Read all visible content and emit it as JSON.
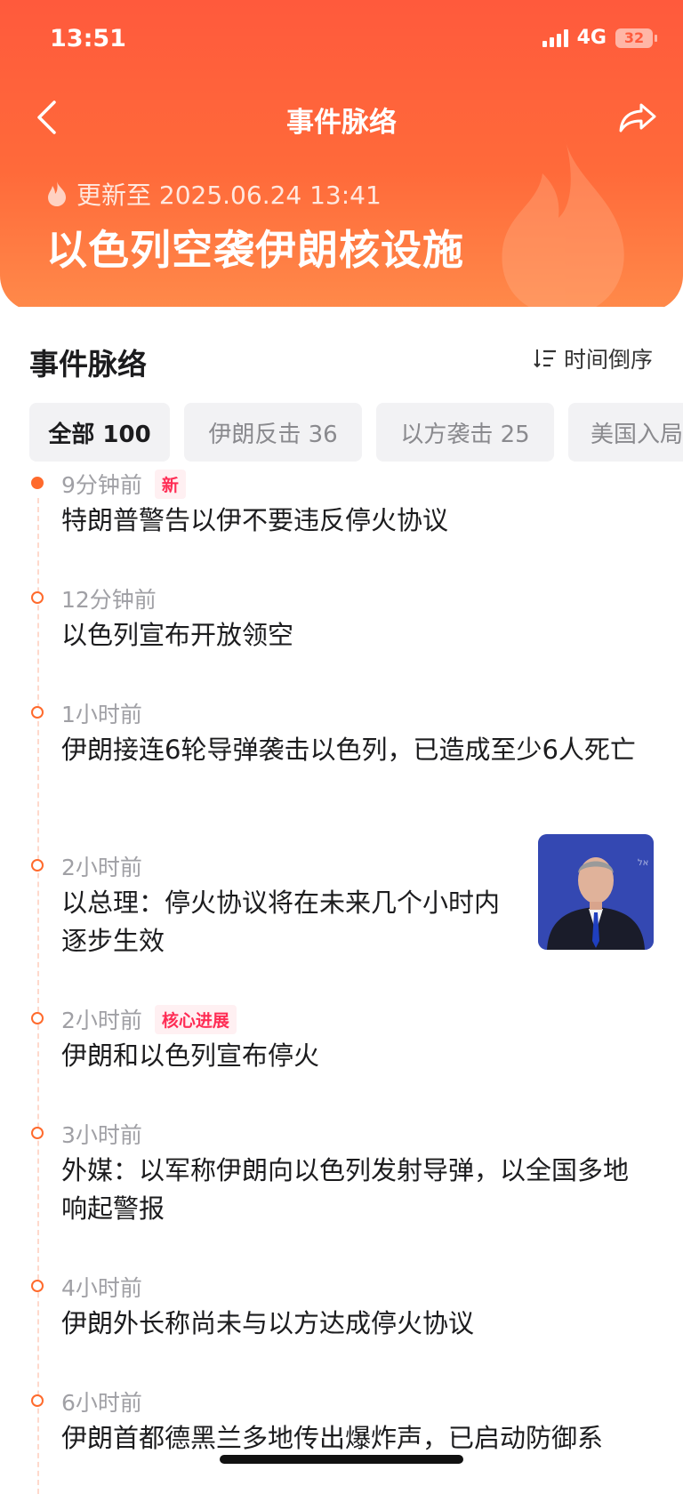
{
  "status_bar": {
    "time": "13:51",
    "network": "4G",
    "battery": "32"
  },
  "nav": {
    "title": "事件脉络",
    "back_icon": "chevron-left-icon",
    "share_icon": "share-icon"
  },
  "hero": {
    "update_text": "更新至 2025.06.24 13:41",
    "event_title": "以色列空袭伊朗核设施",
    "colors": {
      "gradient_top": "#ff5a3c",
      "gradient_bottom": "#ff8a4a"
    }
  },
  "section": {
    "title": "事件脉络",
    "sort_label": "时间倒序"
  },
  "filters": [
    {
      "label": "全部 100",
      "active": true
    },
    {
      "label": "伊朗反击 36",
      "active": false
    },
    {
      "label": "以方袭击 25",
      "active": false
    },
    {
      "label": "美国入局",
      "active": false
    }
  ],
  "timeline": [
    {
      "time": "9分钟前",
      "tag": "新",
      "headline": "特朗普警告以伊不要违反停火协议"
    },
    {
      "time": "12分钟前",
      "tag": "",
      "headline": "以色列宣布开放领空"
    },
    {
      "time": "1小时前",
      "tag": "",
      "headline": "伊朗接连6轮导弹袭击以色列，已造成至少6人死亡"
    },
    {
      "time": "2小时前",
      "tag": "",
      "headline": "以总理：停火协议将在未来几个小时内逐步生效"
    },
    {
      "time": "2小时前",
      "tag": "核心进展",
      "headline": "伊朗和以色列宣布停火"
    },
    {
      "time": "3小时前",
      "tag": "",
      "headline": "外媒：以军称伊朗向以色列发射导弹，以全国多地响起警报"
    },
    {
      "time": "4小时前",
      "tag": "",
      "headline": "伊朗外长称尚未与以方达成停火协议"
    },
    {
      "time": "6小时前",
      "tag": "",
      "headline": "伊朗首都德黑兰多地传出爆炸声，已启动防御系"
    }
  ],
  "accent": "#ff6a2c",
  "tag_color": "#ff2d55"
}
